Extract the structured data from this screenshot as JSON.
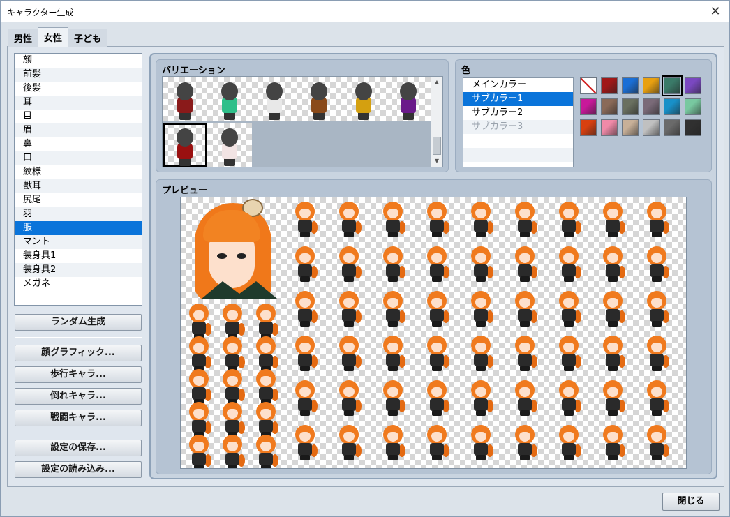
{
  "window": {
    "title": "キャラクター生成",
    "close_glyph": "✕"
  },
  "tabs": [
    {
      "label": "男性",
      "active": false
    },
    {
      "label": "女性",
      "active": true
    },
    {
      "label": "子ども",
      "active": false
    }
  ],
  "parts": {
    "items": [
      "顔",
      "前髪",
      "後髪",
      "耳",
      "目",
      "眉",
      "鼻",
      "口",
      "紋様",
      "獣耳",
      "尻尾",
      "羽",
      "服",
      "マント",
      "装身具1",
      "装身具2",
      "メガネ"
    ],
    "selected": "服"
  },
  "buttons": {
    "random": "ランダム生成",
    "face_graphic": "顔グラフィック...",
    "walk_char": "歩行キャラ...",
    "down_char": "倒れキャラ...",
    "battle_char": "戦闘キャラ...",
    "save_settings": "設定の保存...",
    "load_settings": "設定の読み込み...",
    "close": "閉じる"
  },
  "variation": {
    "label": "バリエーション",
    "selected_index": 6,
    "body_colors": [
      "#8a1a1a",
      "#2fbf8a",
      "#e8e8e8",
      "#8a4a1a",
      "#d4a010",
      "#6a1a8a",
      "#9a1010",
      "#f2e4e4"
    ],
    "scroll_up": "▲",
    "scroll_down": "▼"
  },
  "color": {
    "label": "色",
    "items": [
      "メインカラー",
      "サブカラー1",
      "サブカラー2",
      "サブカラー3"
    ],
    "selected": "サブカラー1",
    "disabled": [
      "サブカラー3"
    ],
    "swatches": [
      "none",
      "#a01818",
      "#1a6fd6",
      "#e8a010",
      "#3a7a68",
      "#7a48c0",
      "#c8189a",
      "#8a6a58",
      "#6a7060",
      "#7a6a78",
      "#1890c8",
      "#78c8a0",
      "#d84010",
      "#f08aa8",
      "#c8b098",
      "#c0c0c0",
      "#6a6a6a",
      "#303030"
    ],
    "selected_swatch": 4
  },
  "preview": {
    "label": "プレビュー"
  }
}
